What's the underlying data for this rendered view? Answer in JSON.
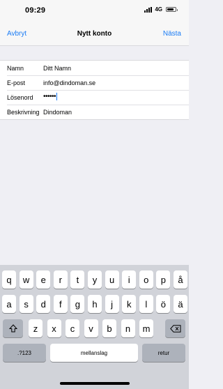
{
  "status_bar": {
    "time": "09:29",
    "network": "4G",
    "battery_level": 0.8
  },
  "nav": {
    "cancel_label": "Avbryt",
    "title": "Nytt konto",
    "next_label": "Nästa",
    "accent_color": "#1a7cf5"
  },
  "form": {
    "rows": [
      {
        "label": "Namn",
        "value": "Ditt Namn"
      },
      {
        "label": "E-post",
        "value": "info@dindoman.se"
      },
      {
        "label": "Lösenord",
        "value": "••••••"
      },
      {
        "label": "Beskrivning",
        "value": "Dindoman"
      }
    ]
  },
  "keyboard": {
    "row1": [
      "q",
      "w",
      "e",
      "r",
      "t",
      "y",
      "u",
      "i",
      "o",
      "p",
      "å"
    ],
    "row2": [
      "a",
      "s",
      "d",
      "f",
      "g",
      "h",
      "j",
      "k",
      "l",
      "ö",
      "ä"
    ],
    "row3": [
      "z",
      "x",
      "c",
      "v",
      "b",
      "n",
      "m"
    ],
    "shift_icon": "shift-icon",
    "delete_icon": "delete-icon",
    "numbers_label": ".?123",
    "space_label": "mellanslag",
    "return_label": "retur"
  }
}
